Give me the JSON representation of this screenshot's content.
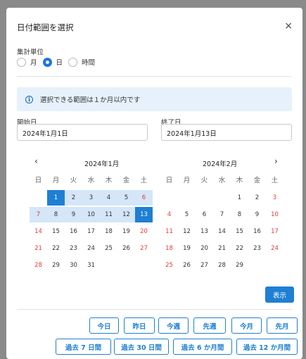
{
  "dialog": {
    "title": "日付範囲を選択",
    "close_glyph": "×"
  },
  "unit": {
    "label": "集計単位",
    "options": [
      {
        "label": "月",
        "checked": false
      },
      {
        "label": "日",
        "checked": true
      },
      {
        "label": "時間",
        "checked": false
      }
    ]
  },
  "info": {
    "icon_glyph": "i",
    "text": "選択できる範囲は１か月以内です"
  },
  "start": {
    "label": "開始日",
    "value": "2024年1月1日"
  },
  "end": {
    "label": "終了日",
    "value": "2024年1月13日"
  },
  "calendar": {
    "prev_glyph": "‹",
    "next_glyph": "›",
    "weekdays": [
      "日",
      "月",
      "火",
      "水",
      "木",
      "金",
      "土"
    ],
    "months": [
      {
        "title": "2024年1月",
        "weeks": [
          [
            "",
            "1",
            "2",
            "3",
            "4",
            "5",
            "6"
          ],
          [
            "7",
            "8",
            "9",
            "10",
            "11",
            "12",
            "13"
          ],
          [
            "14",
            "15",
            "16",
            "17",
            "18",
            "19",
            "20"
          ],
          [
            "21",
            "22",
            "23",
            "24",
            "25",
            "26",
            "27"
          ],
          [
            "28",
            "29",
            "30",
            "31",
            "",
            "",
            ""
          ]
        ],
        "selected_start": "1",
        "selected_end": "13"
      },
      {
        "title": "2024年2月",
        "weeks": [
          [
            "",
            "",
            "",
            "",
            "1",
            "2",
            "3"
          ],
          [
            "4",
            "5",
            "6",
            "7",
            "8",
            "9",
            "10"
          ],
          [
            "11",
            "12",
            "13",
            "14",
            "15",
            "16",
            "17"
          ],
          [
            "18",
            "19",
            "20",
            "21",
            "22",
            "23",
            "24"
          ],
          [
            "25",
            "26",
            "27",
            "28",
            "29",
            "",
            ""
          ]
        ],
        "selected_start": "",
        "selected_end": ""
      }
    ]
  },
  "show_button": "表示",
  "quick_row1": [
    "今日",
    "昨日",
    "今週",
    "先週",
    "今月",
    "先月"
  ],
  "quick_row2": [
    "過去 7 日間",
    "過去 30 日間",
    "過去 6 か月間",
    "過去 12 か月間"
  ],
  "colors": {
    "accent": "#1e7fd4",
    "range": "#d4e6f8",
    "weekend_red": "#e53935",
    "info_bg": "#e6f1fb"
  }
}
